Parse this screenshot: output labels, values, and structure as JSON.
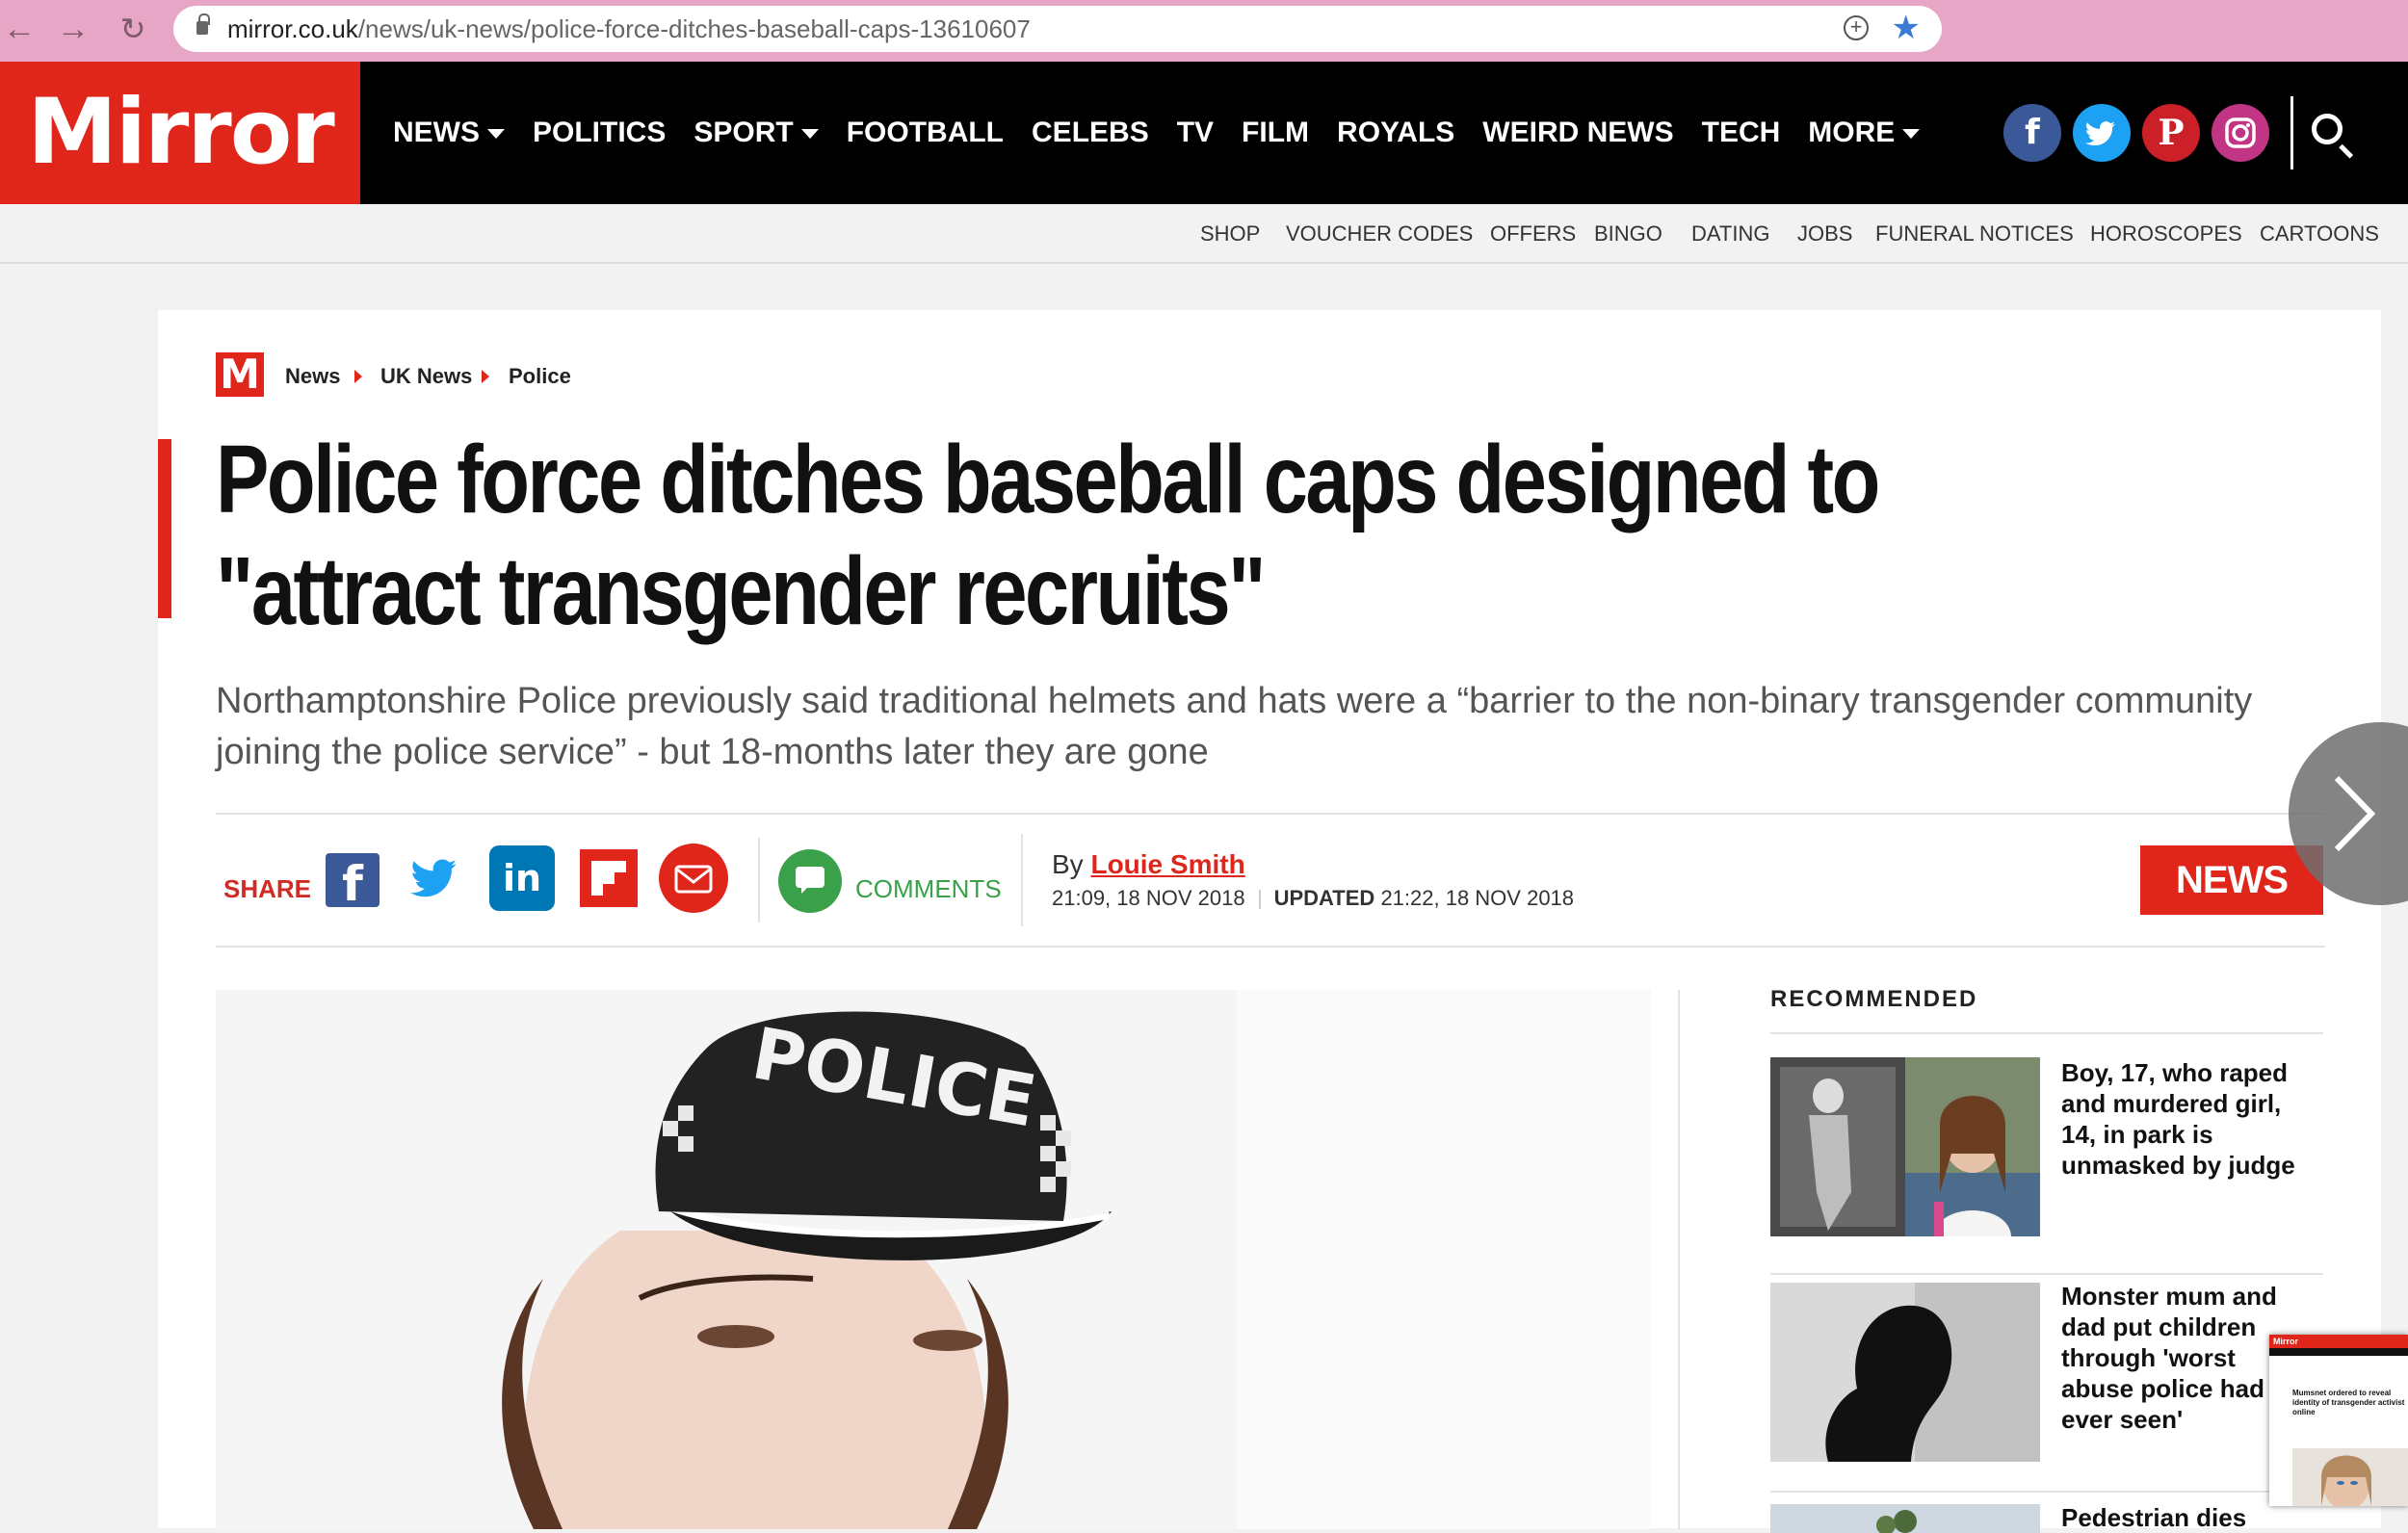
{
  "browser": {
    "url_domain": "mirror.co.uk",
    "url_path": "/news/uk-news/police-force-ditches-baseball-caps-13610607"
  },
  "header": {
    "logo": "Mirror",
    "nav": [
      "NEWS",
      "POLITICS",
      "SPORT",
      "FOOTBALL",
      "CELEBS",
      "TV",
      "FILM",
      "ROYALS",
      "WEIRD NEWS",
      "TECH",
      "MORE"
    ],
    "social": [
      "f",
      "t",
      "p",
      "ig"
    ],
    "social_colors": [
      "#3b5998",
      "#1da1f2",
      "#cb2027",
      "#c13584"
    ]
  },
  "subnav": [
    "SHOP",
    "VOUCHER CODES",
    "OFFERS",
    "BINGO",
    "DATING",
    "JOBS",
    "FUNERAL NOTICES",
    "HOROSCOPES",
    "CARTOONS"
  ],
  "breadcrumb": {
    "logo": "M",
    "items": [
      "News",
      "UK News",
      "Police"
    ]
  },
  "article": {
    "headline": "Police force ditches baseball caps designed to \"attract transgender recruits\"",
    "standfirst": "Northamptonshire Police previously said traditional helmets and hats were a “barrier to the non-binary transgender community joining the police service” - but 18-months later they are gone",
    "share_label": "SHARE",
    "comments_label": "COMMENTS",
    "by_prefix": "By",
    "author": "Louie Smith",
    "published": "21:09, 18 NOV 2018",
    "updated_label": "UPDATED",
    "updated": "21:22, 18 NOV 2018",
    "tag": "NEWS",
    "image_cap_text": "POLICE"
  },
  "recommended": {
    "title": "RECOMMENDED",
    "items": [
      "Boy, 17, who raped and murdered girl, 14, in park is unmasked by judge",
      "Monster mum and dad put children through 'worst abuse police had ever seen'",
      "Pedestrian dies"
    ]
  },
  "thumb": {
    "logo": "Mirror",
    "headline": "Mumsnet ordered to reveal identity of transgender activist online"
  },
  "colors": {
    "accent": "#e0251b",
    "header_bg": "#000000",
    "comments_green": "#3aa14a"
  }
}
